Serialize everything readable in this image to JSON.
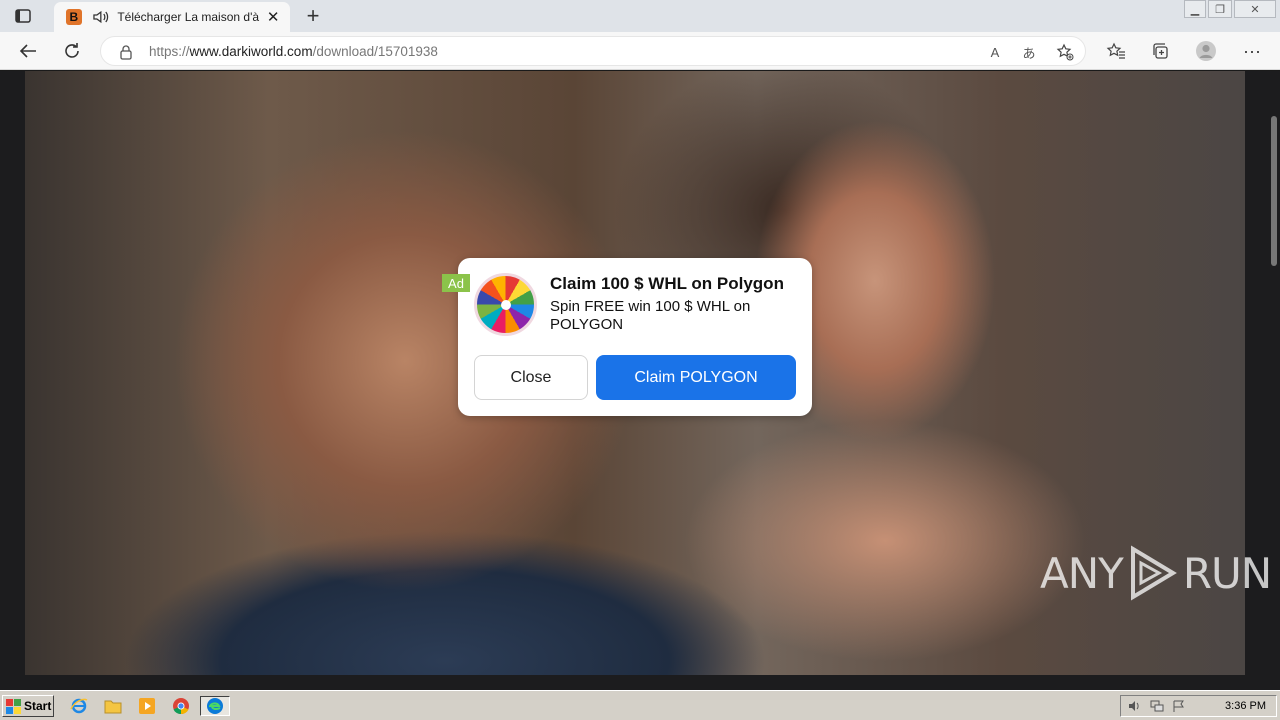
{
  "browser": {
    "tab": {
      "title": "Télécharger La maison d'à",
      "favicon_letter": "B",
      "close_glyph": "✕"
    },
    "new_tab_glyph": "+",
    "window_controls": [
      "▁",
      "❐",
      "✕"
    ],
    "address": {
      "scheme": "https://",
      "host": "www.darkiworld.com",
      "path": "/download/15701938"
    },
    "omnibox_icons": [
      "read-aloud-icon",
      "translate-icon",
      "add-favorite-icon"
    ],
    "toolbar_icons": [
      "favorites-icon",
      "collections-icon",
      "profile-icon",
      "more-icon"
    ],
    "read_aloud_glyph": "A",
    "translate_glyph": "あ",
    "more_glyph": "···"
  },
  "ad_popup": {
    "badge": "Ad",
    "title": "Claim 100 $ WHL on Polygon",
    "body": "Spin FREE win 100 $ WHL on POLYGON",
    "close_label": "Close",
    "cta_label": "Claim POLYGON"
  },
  "watermark": {
    "left": "ANY",
    "right": "RUN"
  },
  "taskbar": {
    "start_label": "Start",
    "apps": [
      "ie-icon",
      "explorer-icon",
      "media-player-icon",
      "chrome-icon",
      "edge-icon"
    ],
    "clock": "3:36 PM"
  },
  "colors": {
    "cta": "#1a73e8",
    "ad_badge": "#8bc34a",
    "tabstrip": "#dfe3e8"
  }
}
